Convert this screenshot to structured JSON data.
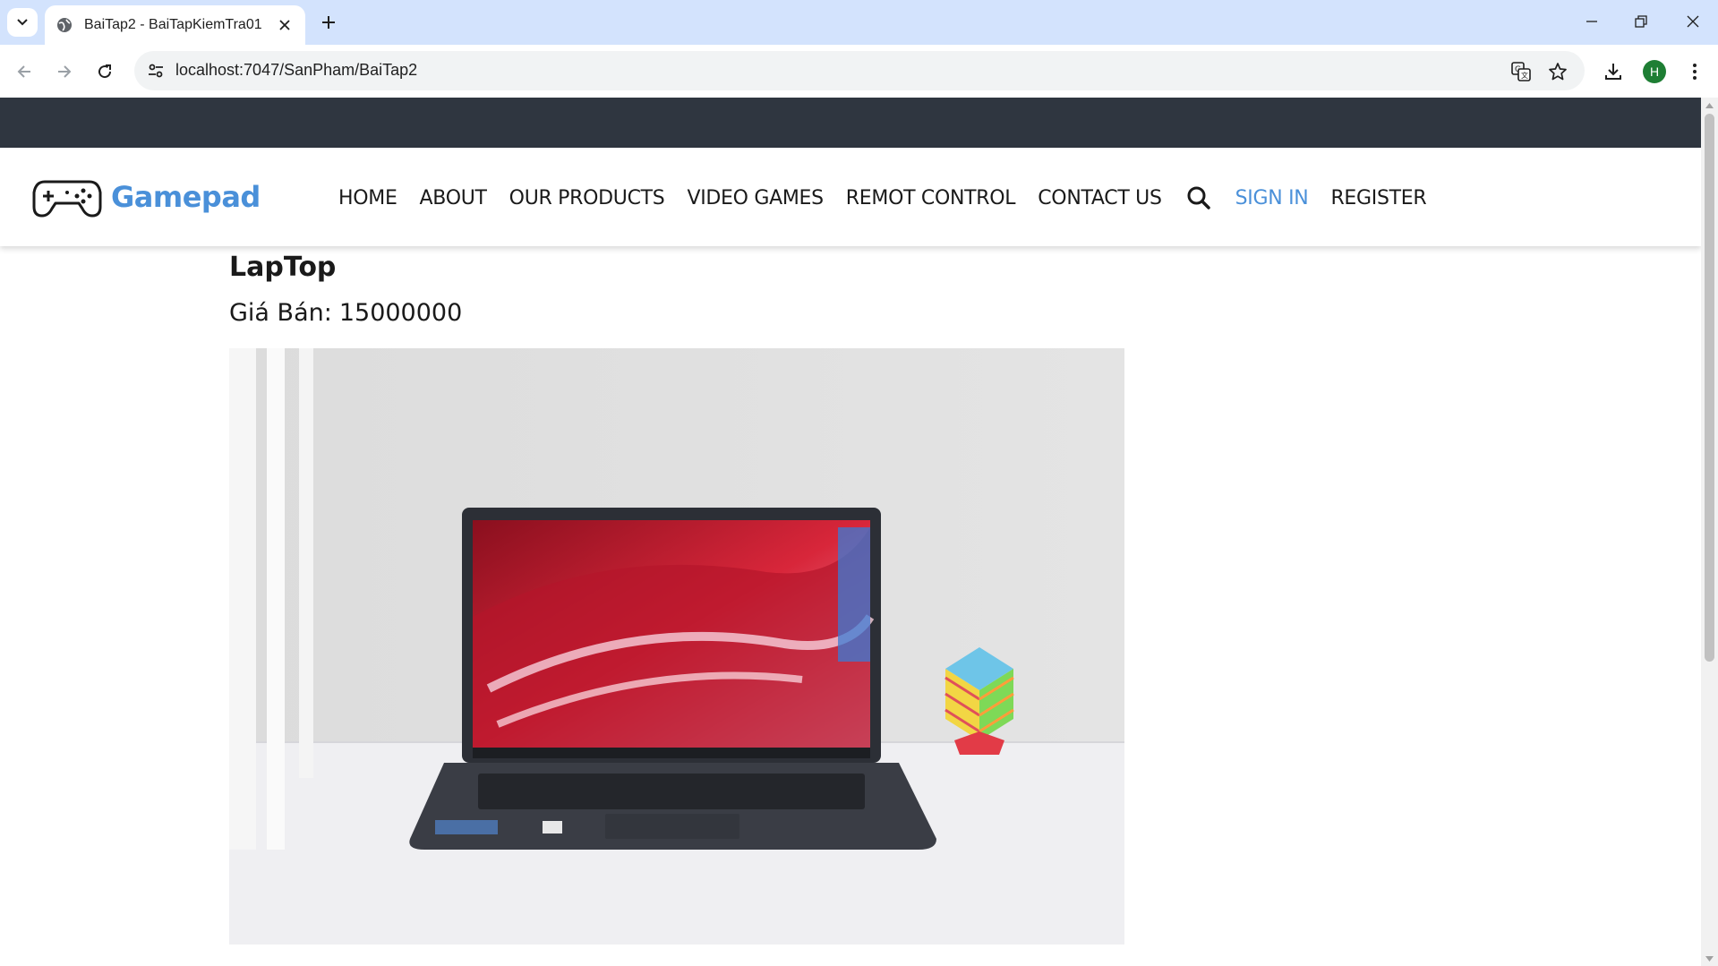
{
  "browser": {
    "tab_title": "BaiTap2 - BaiTapKiemTra01",
    "url": "localhost:7047/SanPham/BaiTap2",
    "profile_initial": "H"
  },
  "site": {
    "brand": "Gamepad",
    "brand_color": "#4a90d9",
    "topbar_color": "#2f3640",
    "nav": [
      {
        "label": "HOME"
      },
      {
        "label": "ABOUT"
      },
      {
        "label": "OUR PRODUCTS"
      },
      {
        "label": "VIDEO GAMES"
      },
      {
        "label": "REMOT CONTROL"
      },
      {
        "label": "CONTACT US"
      }
    ],
    "sign_in": "SIGN IN",
    "register": "REGISTER"
  },
  "product": {
    "name": "LapTop",
    "price_label": "Giá Bán:",
    "price": "15000000"
  }
}
